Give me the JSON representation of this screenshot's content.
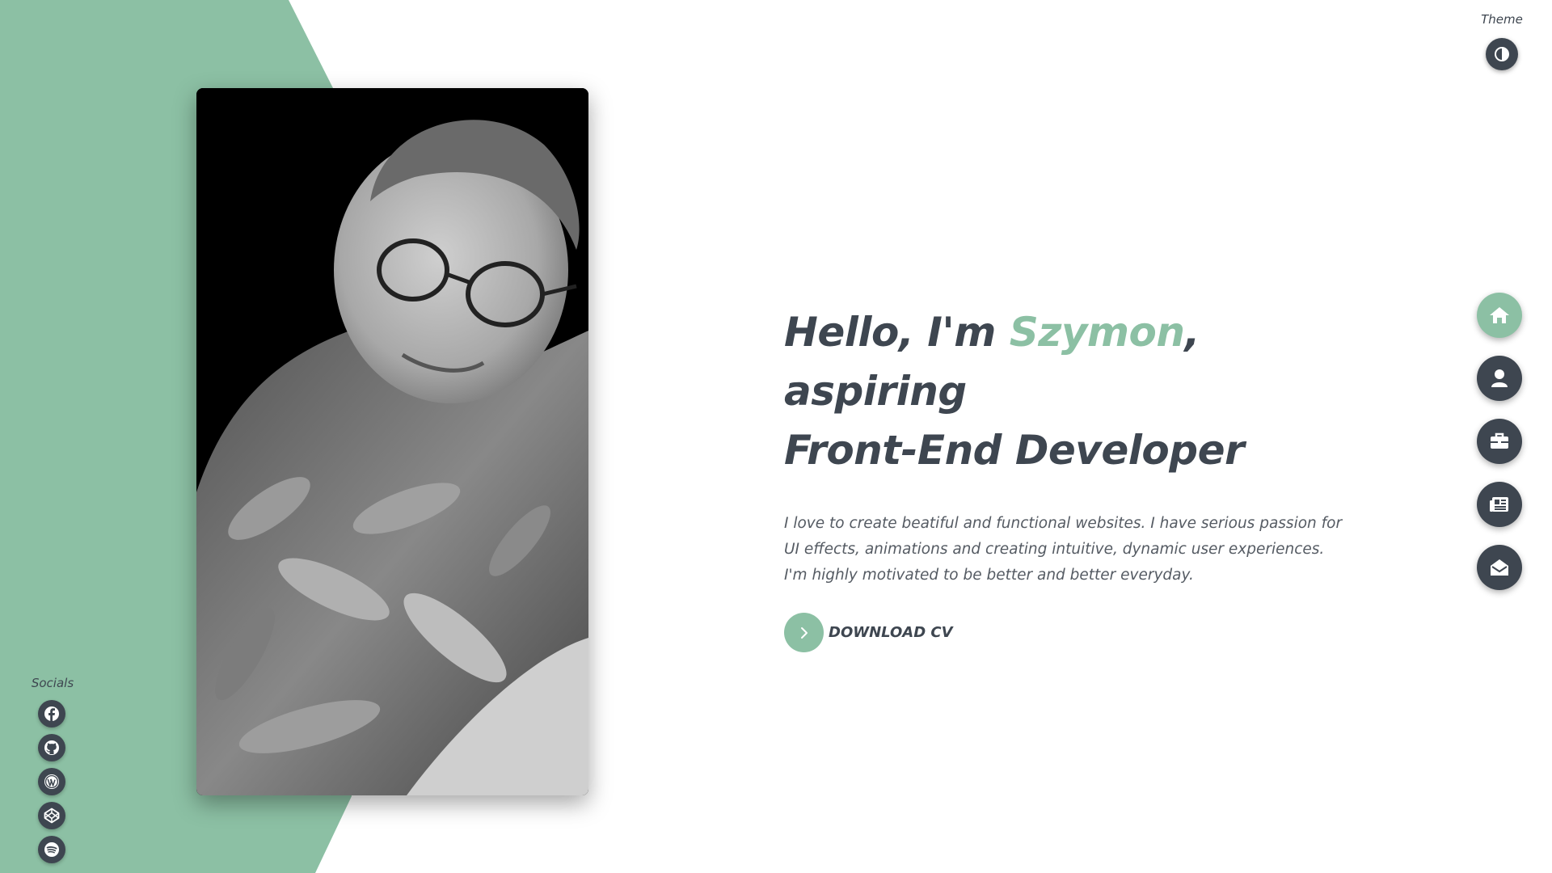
{
  "theme": {
    "label": "Theme",
    "toggle_icon": "half-circle-contrast-icon"
  },
  "hero": {
    "greeting": "Hello, I'm ",
    "name": "Szymon",
    "rest_line1": ", aspiring",
    "line2": "Front-End Developer",
    "description": "I love to create beatiful and functional websites. I have serious passion for UI effects, animations and creating intuitive, dynamic user experiences. I'm highly motivated to be better and better everyday.",
    "cv_button_label": "Download CV",
    "cv_button_icon": "chevron-right-icon"
  },
  "nav": {
    "items": [
      {
        "icon": "home-icon",
        "active": true
      },
      {
        "icon": "user-icon",
        "active": false
      },
      {
        "icon": "briefcase-icon",
        "active": false
      },
      {
        "icon": "newspaper-icon",
        "active": false
      },
      {
        "icon": "envelope-open-icon",
        "active": false
      }
    ]
  },
  "socials": {
    "label": "Socials",
    "items": [
      {
        "icon": "facebook-icon"
      },
      {
        "icon": "github-icon"
      },
      {
        "icon": "wordpress-icon"
      },
      {
        "icon": "codepen-icon"
      },
      {
        "icon": "spotify-icon"
      }
    ]
  },
  "colors": {
    "accent": "#8cc0a4",
    "dark": "#3e4650",
    "text": "#555b63",
    "background": "#ffffff"
  }
}
